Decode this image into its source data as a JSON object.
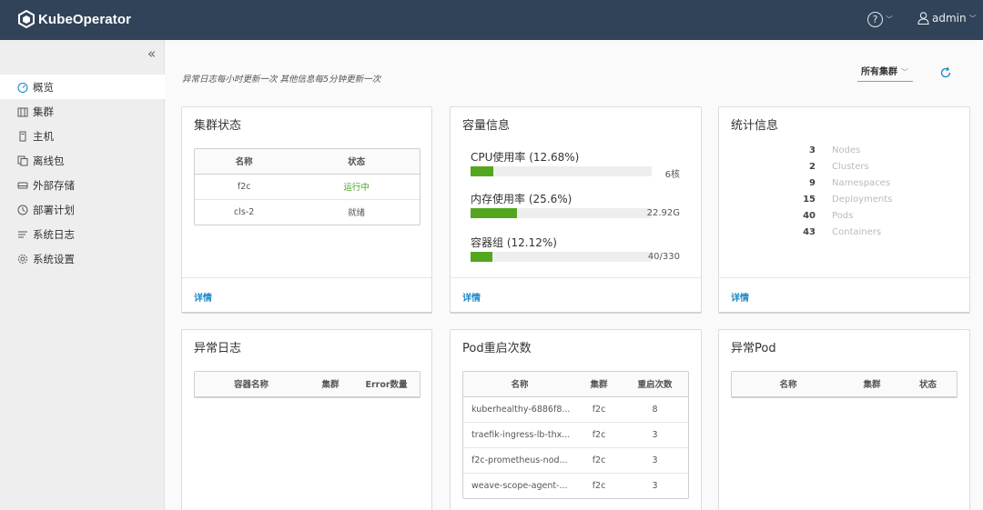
{
  "header": {
    "app_name": "KubeOperator",
    "help_glyph": "?",
    "user_name": "admin"
  },
  "sidebar": {
    "collapse_glyph": "«",
    "items": [
      {
        "label": "概览",
        "icon": "dashboard-icon",
        "active": true
      },
      {
        "label": "集群",
        "icon": "cluster-icon"
      },
      {
        "label": "主机",
        "icon": "host-icon"
      },
      {
        "label": "离线包",
        "icon": "package-icon"
      },
      {
        "label": "外部存储",
        "icon": "storage-icon"
      },
      {
        "label": "部署计划",
        "icon": "plan-icon"
      },
      {
        "label": "系统日志",
        "icon": "log-icon"
      },
      {
        "label": "系统设置",
        "icon": "gear-icon"
      }
    ]
  },
  "main": {
    "notice": "异常日志每小时更新一次 其他信息每5分钟更新一次",
    "cluster_select": "所有集群",
    "detail_label": "详情"
  },
  "cluster_status": {
    "title": "集群状态",
    "headers": [
      "名称",
      "状态"
    ],
    "rows": [
      {
        "name": "f2c",
        "status": "运行中"
      },
      {
        "name": "cls-2",
        "status": "就绪"
      }
    ]
  },
  "capacity": {
    "title": "容量信息",
    "items": [
      {
        "label": "CPU使用率 (12.68%)",
        "value": "6核",
        "percent": 12.68
      },
      {
        "label": "内存使用率 (25.6%)",
        "value": "22.92G",
        "percent": 25.6
      },
      {
        "label": "容器组 (12.12%)",
        "value": "40/330",
        "percent": 12.12
      }
    ]
  },
  "statistics": {
    "title": "统计信息",
    "items": [
      {
        "count": "3",
        "name": "Nodes"
      },
      {
        "count": "2",
        "name": "Clusters"
      },
      {
        "count": "9",
        "name": "Namespaces"
      },
      {
        "count": "15",
        "name": "Deployments"
      },
      {
        "count": "40",
        "name": "Pods"
      },
      {
        "count": "43",
        "name": "Containers"
      }
    ]
  },
  "error_logs": {
    "title": "异常日志",
    "headers": [
      "容器名称",
      "集群",
      "Error数量"
    ]
  },
  "pod_restarts": {
    "title": "Pod重启次数",
    "headers": [
      "名称",
      "集群",
      "重启次数"
    ],
    "rows": [
      {
        "name": "kuberhealthy-6886f8...",
        "cluster": "f2c",
        "count": "8"
      },
      {
        "name": "traefik-ingress-lb-thx...",
        "cluster": "f2c",
        "count": "3"
      },
      {
        "name": "f2c-prometheus-nod...",
        "cluster": "f2c",
        "count": "3"
      },
      {
        "name": "weave-scope-agent-...",
        "cluster": "f2c",
        "count": "3"
      }
    ]
  },
  "abnormal_pods": {
    "title": "异常Pod",
    "headers": [
      "名称",
      "集群",
      "状态"
    ]
  },
  "colors": {
    "header_bg": "#314359",
    "accent": "#1b88c9",
    "bar_green": "#55a61f",
    "running_green": "#46a62a"
  }
}
